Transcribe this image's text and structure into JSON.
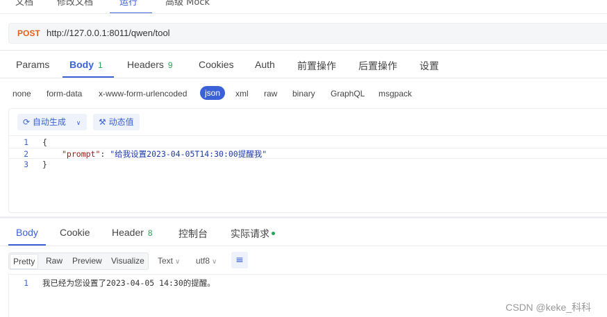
{
  "top_tabs": [
    "文档",
    "修改文档",
    "运行",
    "高级 Mock"
  ],
  "request": {
    "method": "POST",
    "url": "http://127.0.0.1:8011/qwen/tool"
  },
  "request_tabs": [
    {
      "label": "Params"
    },
    {
      "label": "Body",
      "badge": "1"
    },
    {
      "label": "Headers",
      "badge": "9"
    },
    {
      "label": "Cookies"
    },
    {
      "label": "Auth"
    },
    {
      "label": "前置操作"
    },
    {
      "label": "后置操作"
    },
    {
      "label": "设置"
    }
  ],
  "body_types": [
    "none",
    "form-data",
    "x-www-form-urlencoded",
    "json",
    "xml",
    "raw",
    "binary",
    "GraphQL",
    "msgpack"
  ],
  "editor": {
    "auto_generate": "自动生成",
    "dynamic_value": "动态值",
    "lines": [
      {
        "n": "1",
        "text": "{"
      },
      {
        "n": "2",
        "key": "\"prompt\"",
        "colon": ": ",
        "value": "\"给我设置2023-04-05T14:30:00提醒我\""
      },
      {
        "n": "3",
        "text": "}"
      }
    ]
  },
  "response_tabs": [
    {
      "label": "Body"
    },
    {
      "label": "Cookie"
    },
    {
      "label": "Header",
      "badge": "8"
    },
    {
      "label": "控制台"
    },
    {
      "label": "实际请求"
    }
  ],
  "view_modes": [
    "Pretty",
    "Raw",
    "Preview",
    "Visualize"
  ],
  "format_select": "Text",
  "encoding_select": "utf8",
  "response_lines": [
    {
      "n": "1",
      "text": "我已经为您设置了2023-04-05 14:30的提醒。"
    }
  ],
  "watermark": "CSDN @keke_科科",
  "colors": {
    "accent": "#3a62d6",
    "method": "#e2611c",
    "badge": "#27a55a"
  }
}
